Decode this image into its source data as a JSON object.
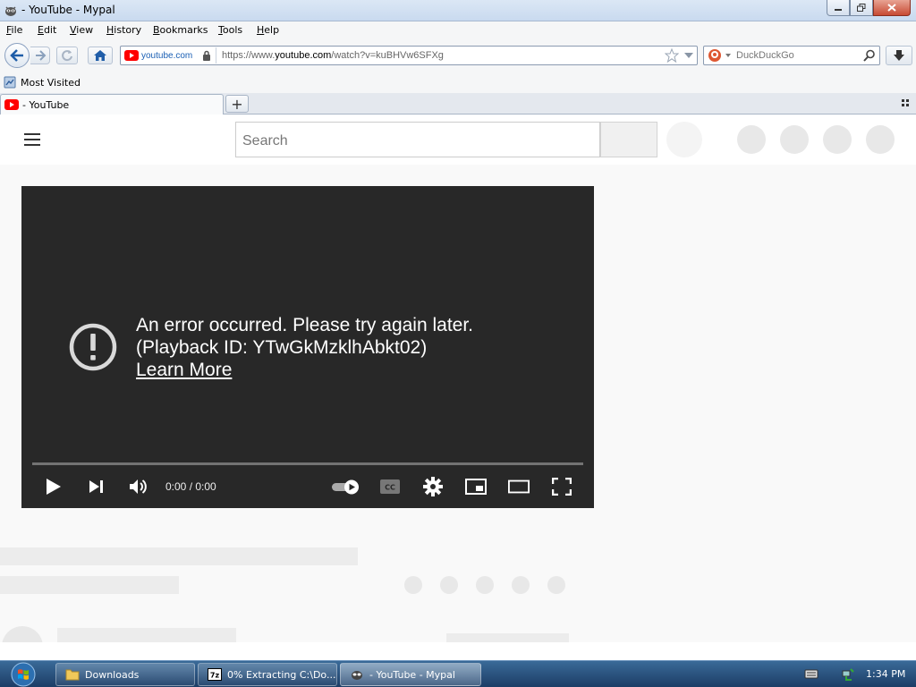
{
  "window": {
    "title": "- YouTube - Mypal"
  },
  "menu": {
    "items": [
      "File",
      "Edit",
      "View",
      "History",
      "Bookmarks",
      "Tools",
      "Help"
    ]
  },
  "navbar": {
    "identity_site": "youtube.com",
    "url_prefix": "https://www.",
    "url_domain": "youtube.com",
    "url_path": "/watch?v=kuBHVw6SFXg",
    "search_placeholder": "DuckDuckGo"
  },
  "bookmarks": {
    "most_visited": "Most Visited"
  },
  "tabs": [
    {
      "label": "- YouTube"
    }
  ],
  "youtube": {
    "search_placeholder": "Search",
    "error_line1": "An error occurred. Please try again later.",
    "error_line2": "(Playback ID: YTwGkMzklhAbkt02)",
    "learn_more": "Learn More",
    "time": "0:00 / 0:00"
  },
  "taskbar": {
    "tasks": [
      {
        "label": "Downloads"
      },
      {
        "label": "0% Extracting C:\\Do..."
      },
      {
        "label": "- YouTube - Mypal"
      }
    ],
    "clock": "1:34 PM"
  },
  "colors": {
    "player_bg": "#282828",
    "youtube_red": "#ff0000",
    "taskbar": "#1c3d66"
  }
}
